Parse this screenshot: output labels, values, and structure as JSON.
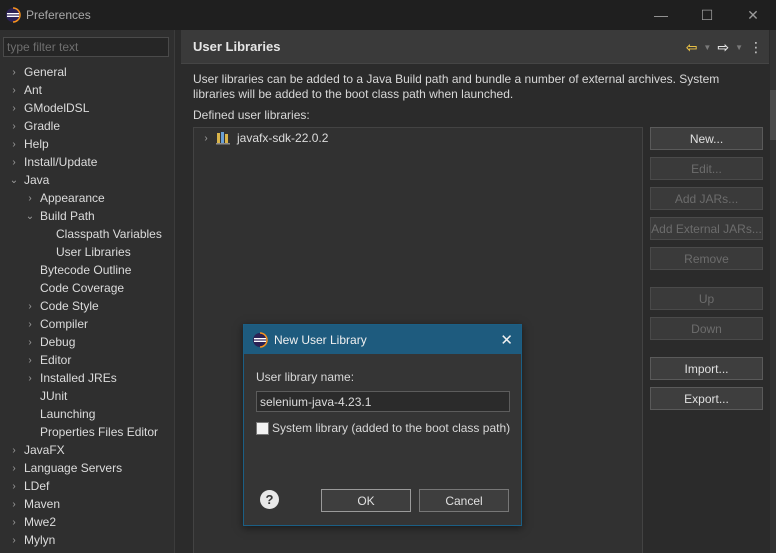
{
  "window": {
    "title": "Preferences",
    "minimize": "—",
    "maximize": "☐",
    "close": "✕"
  },
  "filter": {
    "placeholder": "type filter text"
  },
  "tree": [
    {
      "label": "General",
      "indent": 0,
      "expander": "collapsed"
    },
    {
      "label": "Ant",
      "indent": 0,
      "expander": "collapsed"
    },
    {
      "label": "GModelDSL",
      "indent": 0,
      "expander": "collapsed"
    },
    {
      "label": "Gradle",
      "indent": 0,
      "expander": "collapsed"
    },
    {
      "label": "Help",
      "indent": 0,
      "expander": "collapsed"
    },
    {
      "label": "Install/Update",
      "indent": 0,
      "expander": "collapsed"
    },
    {
      "label": "Java",
      "indent": 0,
      "expander": "expanded"
    },
    {
      "label": "Appearance",
      "indent": 1,
      "expander": "collapsed"
    },
    {
      "label": "Build Path",
      "indent": 1,
      "expander": "expanded"
    },
    {
      "label": "Classpath Variables",
      "indent": 2,
      "expander": "none"
    },
    {
      "label": "User Libraries",
      "indent": 2,
      "expander": "none"
    },
    {
      "label": "Bytecode Outline",
      "indent": 1,
      "expander": "none"
    },
    {
      "label": "Code Coverage",
      "indent": 1,
      "expander": "none"
    },
    {
      "label": "Code Style",
      "indent": 1,
      "expander": "collapsed"
    },
    {
      "label": "Compiler",
      "indent": 1,
      "expander": "collapsed"
    },
    {
      "label": "Debug",
      "indent": 1,
      "expander": "collapsed"
    },
    {
      "label": "Editor",
      "indent": 1,
      "expander": "collapsed"
    },
    {
      "label": "Installed JREs",
      "indent": 1,
      "expander": "collapsed"
    },
    {
      "label": "JUnit",
      "indent": 1,
      "expander": "none"
    },
    {
      "label": "Launching",
      "indent": 1,
      "expander": "none"
    },
    {
      "label": "Properties Files Editor",
      "indent": 1,
      "expander": "none"
    },
    {
      "label": "JavaFX",
      "indent": 0,
      "expander": "collapsed"
    },
    {
      "label": "Language Servers",
      "indent": 0,
      "expander": "collapsed"
    },
    {
      "label": "LDef",
      "indent": 0,
      "expander": "collapsed"
    },
    {
      "label": "Maven",
      "indent": 0,
      "expander": "collapsed"
    },
    {
      "label": "Mwe2",
      "indent": 0,
      "expander": "collapsed"
    },
    {
      "label": "Mylyn",
      "indent": 0,
      "expander": "collapsed"
    }
  ],
  "page": {
    "title": "User Libraries",
    "description": "User libraries can be added to a Java Build path and bundle a number of external archives. System libraries will be added to the boot class path when launched.",
    "defined_label": "Defined user libraries:",
    "libraries": [
      "javafx-sdk-22.0.2"
    ],
    "nav": {
      "back": "⇦",
      "forward": "⇨",
      "menu": "⋮"
    }
  },
  "buttons": [
    {
      "label": "New...",
      "enabled": true
    },
    {
      "label": "Edit...",
      "enabled": false
    },
    {
      "label": "Add JARs...",
      "enabled": false
    },
    {
      "label": "Add External JARs...",
      "enabled": false
    },
    {
      "label": "Remove",
      "enabled": false
    },
    {
      "label": "Up",
      "enabled": false
    },
    {
      "label": "Down",
      "enabled": false
    },
    {
      "label": "Import...",
      "enabled": true
    },
    {
      "label": "Export...",
      "enabled": true
    }
  ],
  "dialog": {
    "title": "New User Library",
    "close": "✕",
    "name_label": "User library name:",
    "name_value": "selenium-java-4.23.1",
    "system_checkbox_label": "System library (added to the boot class path)",
    "system_checked": false,
    "help": "?",
    "ok_label": "OK",
    "cancel_label": "Cancel"
  }
}
